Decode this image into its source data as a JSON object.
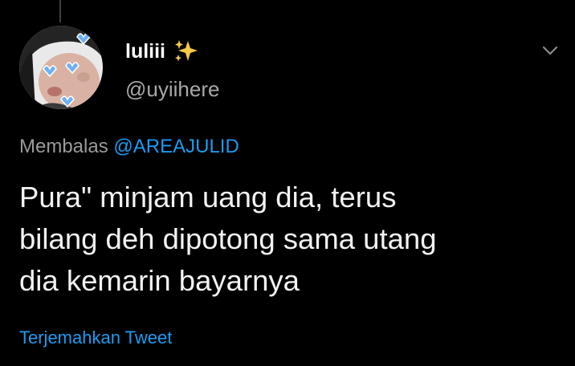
{
  "tweet": {
    "author": {
      "display_name": "luliii",
      "name_emoji": "sparkles-icon",
      "handle": "@uyiihere",
      "avatar": "profile-photo"
    },
    "menu_icon": "chevron-down-icon",
    "reply_context": {
      "prefix": "Membalas",
      "mention": "@AREAJULID"
    },
    "text_lines": [
      "Pura\" minjam uang dia, terus",
      "bilang deh dipotong sama utang",
      "dia kemarin bayarnya"
    ],
    "translate_label": "Terjemahkan Tweet"
  },
  "colors": {
    "background": "#000000",
    "link": "#1d9bf0",
    "muted_text": "#9a9a9a",
    "primary_text": "#f2f2f2"
  }
}
